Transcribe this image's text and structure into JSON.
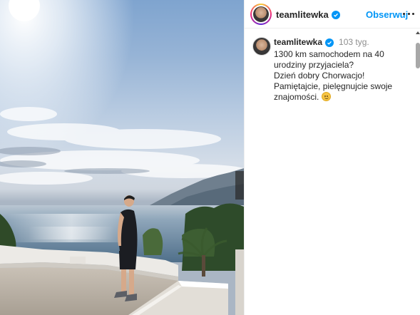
{
  "post": {
    "image": {
      "description_icon": "photo-icon"
    }
  },
  "header": {
    "username": "teamlitewka",
    "follow_label": "Obserwuj",
    "more_icon": "more-horizontal-icon",
    "verified_icon": "verified-badge-icon"
  },
  "caption": {
    "username": "teamlitewka",
    "time": "103 tyg.",
    "lines": [
      "1300 km samochodem na 40 urodziny przyjaciela?",
      "Dzień dobry Chorwacjo!",
      "Pamiętajcie, pielęgnujcie swoje znajomości."
    ],
    "emoji": "smiling-face-icon"
  },
  "colors": {
    "accent": "#0095f6",
    "text": "#262626",
    "muted": "#8e8e8e"
  }
}
